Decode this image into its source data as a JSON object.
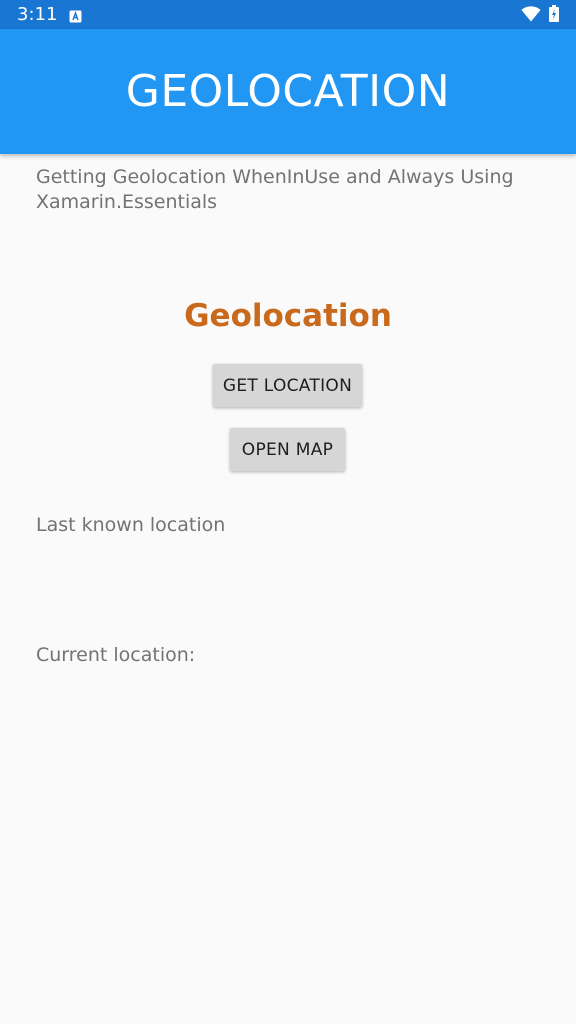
{
  "status_bar": {
    "time": "3:11",
    "icons": [
      "notification-icon",
      "wifi-icon",
      "battery-icon"
    ],
    "background": "#1976d2"
  },
  "app_bar": {
    "title": "GEOLOCATION",
    "background": "#2196f3"
  },
  "main": {
    "description": "Getting Geolocation WhenInUse and Always Using Xamarin.Essentials",
    "heading": "Geolocation",
    "heading_color": "#c8691c",
    "get_location_label": "GET LOCATION",
    "open_map_label": "OPEN MAP",
    "last_known_label": "Last known location",
    "current_label": "Current location:"
  }
}
